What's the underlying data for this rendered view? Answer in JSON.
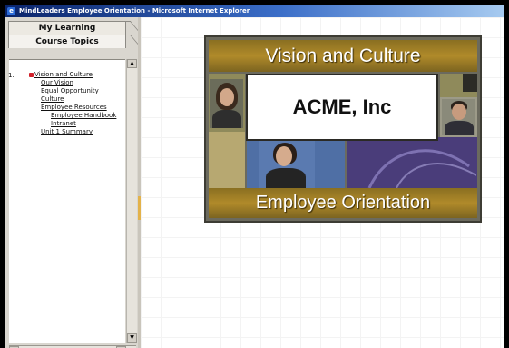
{
  "window": {
    "title": "MindLeaders Employee Orientation - Microsoft Internet Explorer"
  },
  "sidebar": {
    "tabs": [
      {
        "label": "My Learning"
      },
      {
        "label": "Course Topics"
      }
    ],
    "tree": {
      "number": "1.",
      "items": [
        {
          "label": "Vision and Culture",
          "level": 0,
          "selected": true
        },
        {
          "label": "Our Vision",
          "level": 1
        },
        {
          "label": "Equal Opportunity",
          "level": 1
        },
        {
          "label": "Culture",
          "level": 1
        },
        {
          "label": "Employee Resources",
          "level": 1
        },
        {
          "label": "Employee Handbook",
          "level": 2
        },
        {
          "label": "Intranet",
          "level": 2
        },
        {
          "label": "Unit 1 Summary",
          "level": 1
        }
      ]
    },
    "scroll": {
      "up": "▲",
      "down": "▼",
      "left": "◄",
      "right": "►"
    }
  },
  "banner": {
    "top_title": "Vision and Culture",
    "company": "ACME, Inc",
    "bottom_title": "Employee Orientation"
  },
  "colors": {
    "titlebar_start": "#0a246a",
    "banner_gold": "#b08a2a",
    "selection_bullet": "#d0202a"
  }
}
